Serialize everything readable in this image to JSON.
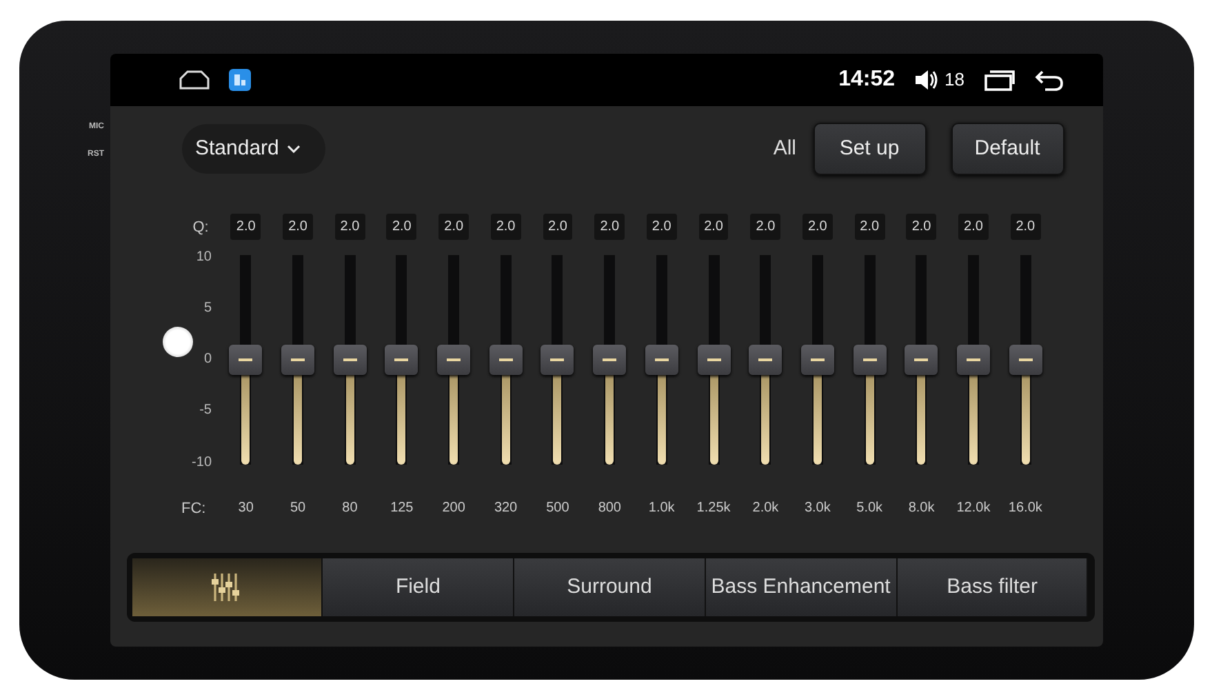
{
  "bezel": {
    "labels": [
      "MIC",
      "RST"
    ]
  },
  "status_bar": {
    "time": "14:52",
    "volume": "18"
  },
  "preset": {
    "label": "Standard"
  },
  "actions": {
    "scope": "All",
    "buttons": [
      "Set up",
      "Default"
    ]
  },
  "equalizer": {
    "q_label": "Q:",
    "fc_label": "FC:",
    "scale": [
      "10",
      "5",
      "0",
      "-5",
      "-10"
    ],
    "bands": [
      {
        "q": "2.0",
        "fc": "30",
        "level": 0.5
      },
      {
        "q": "2.0",
        "fc": "50",
        "level": 0.5
      },
      {
        "q": "2.0",
        "fc": "80",
        "level": 0.5
      },
      {
        "q": "2.0",
        "fc": "125",
        "level": 0.5
      },
      {
        "q": "2.0",
        "fc": "200",
        "level": 0.5
      },
      {
        "q": "2.0",
        "fc": "320",
        "level": 0.5
      },
      {
        "q": "2.0",
        "fc": "500",
        "level": 0.5
      },
      {
        "q": "2.0",
        "fc": "800",
        "level": 0.5
      },
      {
        "q": "2.0",
        "fc": "1.0k",
        "level": 0.5
      },
      {
        "q": "2.0",
        "fc": "1.25k",
        "level": 0.5
      },
      {
        "q": "2.0",
        "fc": "2.0k",
        "level": 0.5
      },
      {
        "q": "2.0",
        "fc": "3.0k",
        "level": 0.5
      },
      {
        "q": "2.0",
        "fc": "5.0k",
        "level": 0.5
      },
      {
        "q": "2.0",
        "fc": "8.0k",
        "level": 0.5
      },
      {
        "q": "2.0",
        "fc": "12.0k",
        "level": 0.5
      },
      {
        "q": "2.0",
        "fc": "16.0k",
        "level": 0.5
      }
    ]
  },
  "tabs": [
    {
      "kind": "icon",
      "selected": true
    },
    {
      "kind": "text",
      "label": "Field",
      "selected": false
    },
    {
      "kind": "text",
      "label": "Surround",
      "selected": false
    },
    {
      "kind": "text",
      "label": "Bass Enhancement",
      "selected": false
    },
    {
      "kind": "text",
      "label": "Bass filter",
      "selected": false
    }
  ]
}
